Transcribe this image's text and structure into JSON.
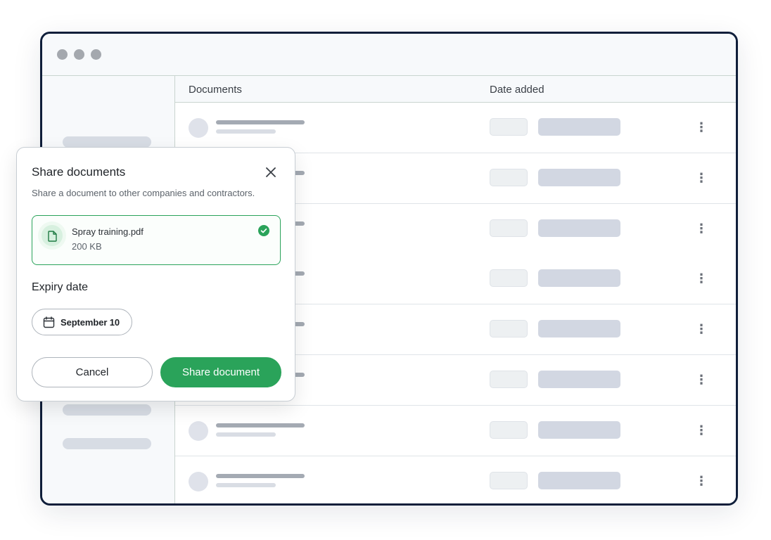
{
  "table": {
    "headers": {
      "documents": "Documents",
      "date_added": "Date added"
    },
    "row_count": 8
  },
  "modal": {
    "title": "Share documents",
    "subtitle": "Share a document to other companies and contractors.",
    "file": {
      "name": "Spray training.pdf",
      "size": "200 KB",
      "status": "uploaded"
    },
    "expiry_label": "Expiry date",
    "expiry_value": "September 10",
    "cancel_label": "Cancel",
    "share_label": "Share document"
  },
  "icons": {
    "close": "close-icon",
    "file": "file-icon",
    "check": "check-circle-icon",
    "calendar": "calendar-icon",
    "more": "kebab-menu-icon"
  },
  "colors": {
    "accent": "#2aa35a",
    "window_border": "#0f1e3a"
  }
}
